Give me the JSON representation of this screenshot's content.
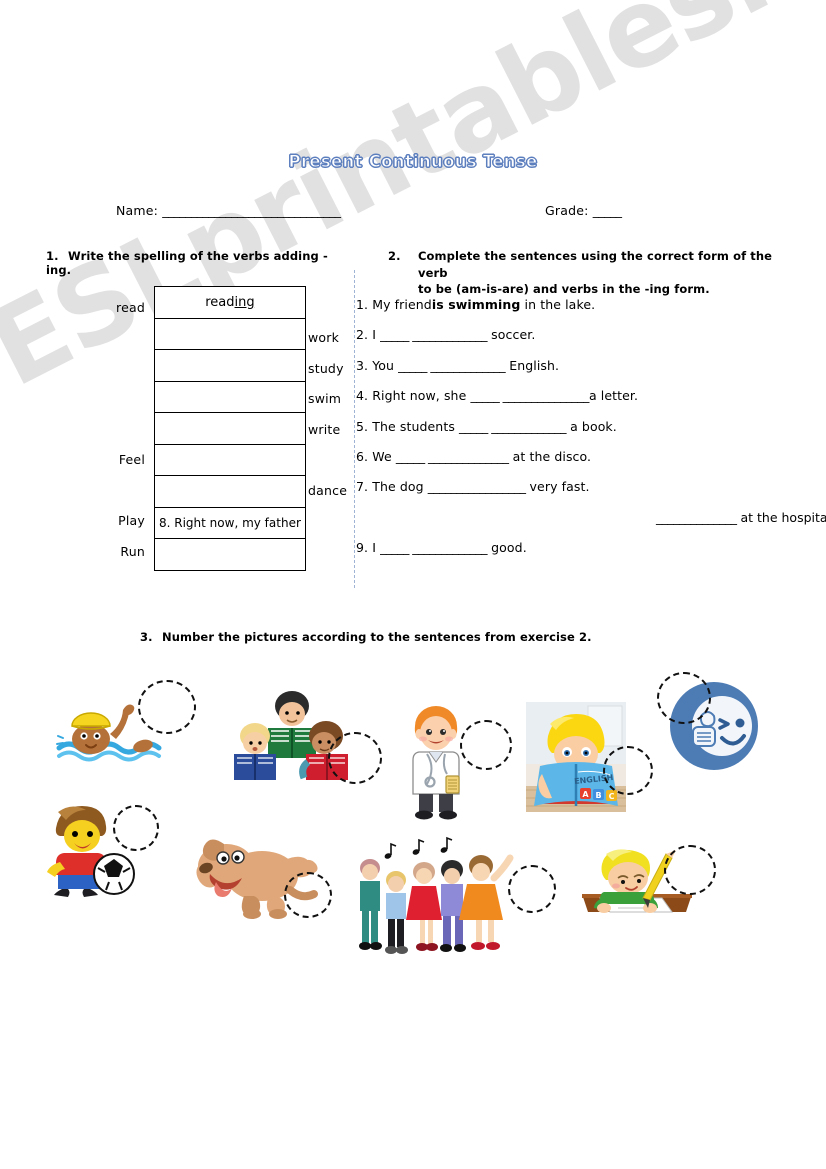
{
  "worksheet": {
    "title": "Present Continuous Tense",
    "name_label": "Name:",
    "name_blank": "_______________________________",
    "grade_label": "Grade:",
    "grade_blank": "_____"
  },
  "exercise1": {
    "number": "1.",
    "instruction": "Write the spelling of the verbs adding -ing.",
    "example_answer": "read",
    "example_suffix": "ing",
    "rows": [
      {
        "left_label": "read",
        "right_label": "",
        "answer": "reading"
      },
      {
        "left_label": "",
        "right_label": "work",
        "answer": ""
      },
      {
        "left_label": "",
        "right_label": "study",
        "answer": ""
      },
      {
        "left_label": "",
        "right_label": "swim",
        "answer": ""
      },
      {
        "left_label": "",
        "right_label": "write",
        "answer": ""
      },
      {
        "left_label": "Feel",
        "right_label": "",
        "answer": ""
      },
      {
        "left_label": "",
        "right_label": "dance",
        "answer": ""
      },
      {
        "left_label": "Play",
        "right_label": "",
        "answer": "8. Right now, my father"
      },
      {
        "left_label": "Run",
        "right_label": "",
        "answer": ""
      }
    ]
  },
  "exercise2": {
    "number": "2.",
    "instruction_line1": "Complete the sentences using the correct form of the verb",
    "instruction_line2": "to be (am-is-are) and verbs in the  -ing form.",
    "sentences": [
      {
        "num": "1.",
        "pre": " My friend",
        "bold": "is swimming",
        "post": " in the lake.",
        "blank": ""
      },
      {
        "num": "2.",
        "pre": " I ",
        "bold": "",
        "post": " soccer.",
        "blank": "_____ _____________"
      },
      {
        "num": "3.",
        "pre": " You ",
        "bold": "",
        "post": " English.",
        "blank": "_____ _____________"
      },
      {
        "num": "4.",
        "pre": " Right now, she ",
        "bold": "",
        "post": "a letter.",
        "blank": "_____ _______________"
      },
      {
        "num": "5.",
        "pre": " The students ",
        "bold": "",
        "post": " a book.",
        "blank": "_____ _____________"
      },
      {
        "num": "6.",
        "pre": " We ",
        "bold": "",
        "post": " at the disco.",
        "blank": "_____ ______________"
      },
      {
        "num": "7.",
        "pre": " The dog ",
        "bold": "",
        "post": " very fast.",
        "blank": "_________________"
      },
      {
        "num": "9.",
        "pre": " I ",
        "bold": "",
        "post": " good.",
        "blank": "_____ _____________"
      }
    ],
    "sentence8": {
      "start": "8. Right now, my father",
      "blank": "______________",
      "end": " at the hospital."
    }
  },
  "exercise3": {
    "number": "3.",
    "instruction": "Number the pictures according to the sentences from exercise 2.",
    "pictures": [
      {
        "name": "swimming-boy",
        "alt": "boy swimming in water with yellow cap"
      },
      {
        "name": "children-reading",
        "alt": "three children reading books"
      },
      {
        "name": "doctor",
        "alt": "doctor in white coat with stethoscope"
      },
      {
        "name": "boy-reading-english-book",
        "alt": "boy reading an ENGLISH ABC book"
      },
      {
        "name": "feeling-good-icon",
        "alt": "blue circle icon winking face with thumbs up"
      },
      {
        "name": "boy-playing-soccer",
        "alt": "boy kicking a soccer ball"
      },
      {
        "name": "running-dog",
        "alt": "dog running fast"
      },
      {
        "name": "people-dancing",
        "alt": "five people dancing with music notes"
      },
      {
        "name": "boy-writing",
        "alt": "boy writing with a pencil at a desk"
      }
    ],
    "book_cover_text_top": "ENGLISH",
    "book_cover_letters": [
      "A",
      "B",
      "C"
    ]
  },
  "watermark": {
    "text": "ESLprintables.com"
  },
  "colors": {
    "title_outline": "#5d7fbe",
    "divider": "#9fb4d4",
    "watermark": "#c9c9c9",
    "icon_blue": "#4d7cb5"
  }
}
